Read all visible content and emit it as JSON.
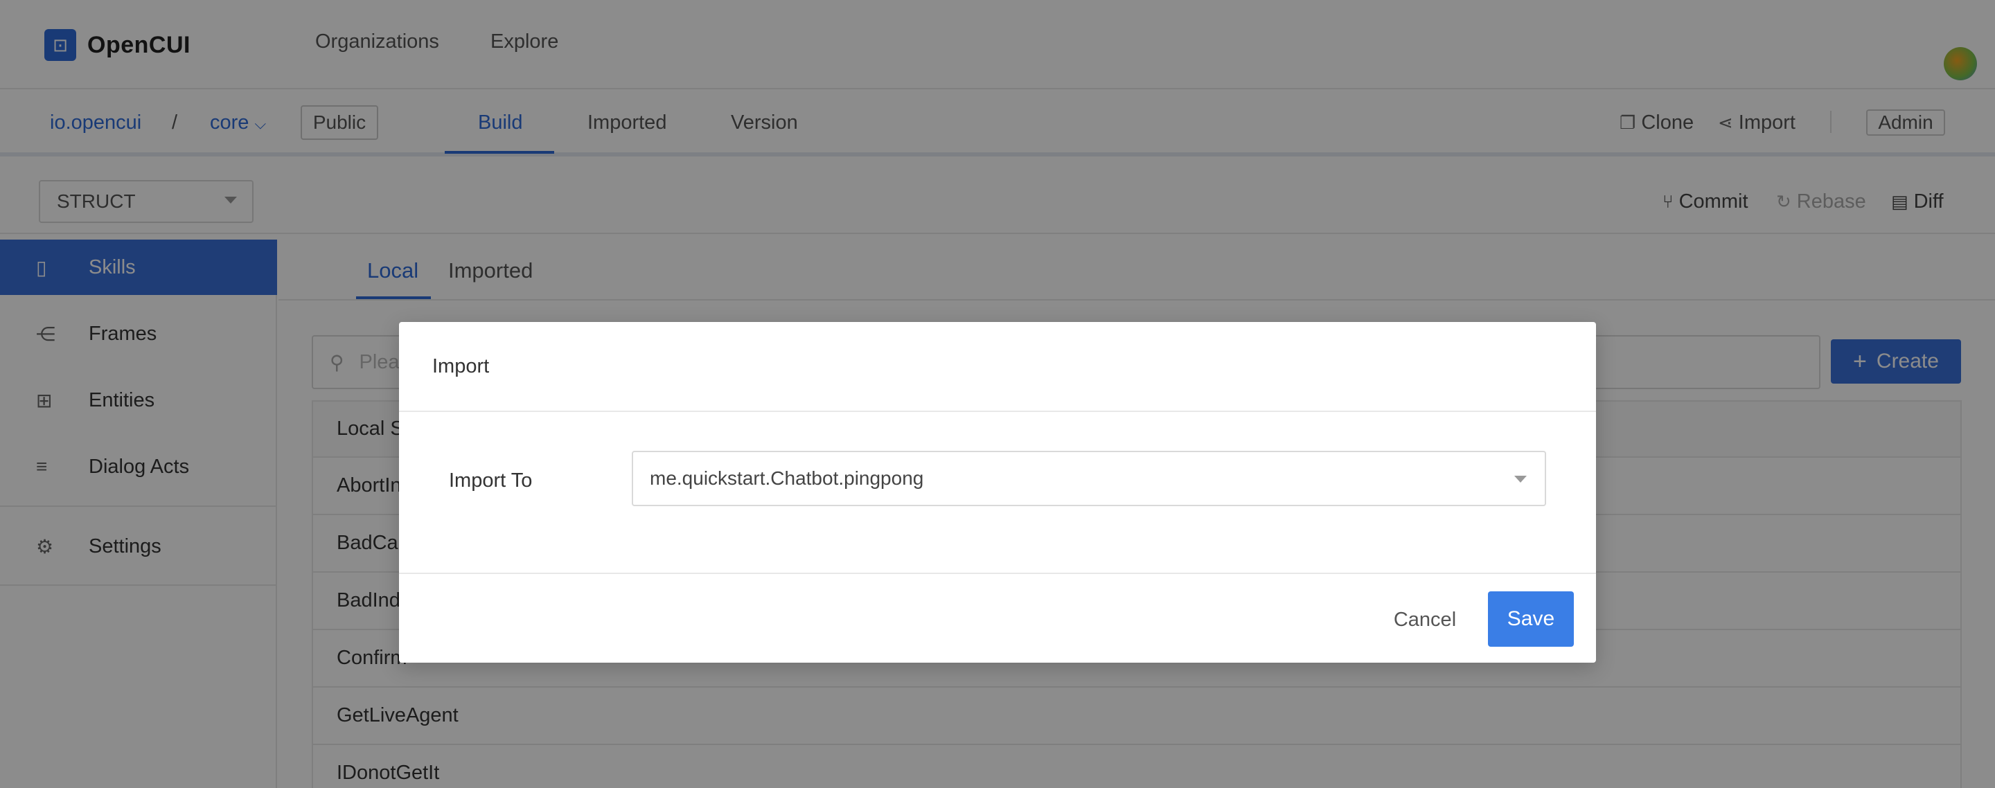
{
  "app": {
    "logo_mark": "⊡",
    "name": "OpenCUI"
  },
  "topnav": {
    "organizations": "Organizations",
    "explore": "Explore"
  },
  "breadcrumb": {
    "org": "io.opencui",
    "sep": "/",
    "project": "core",
    "project_caret": "⌵",
    "visibility": "Public"
  },
  "tabs": {
    "build": "Build",
    "imported": "Imported",
    "version": "Version"
  },
  "header_actions": {
    "clone": "Clone",
    "clone_icon": "❐",
    "import": "Import",
    "import_icon": "⋖",
    "admin": "Admin"
  },
  "toolbar": {
    "struct_value": "STRUCT",
    "commit": "Commit",
    "commit_icon": "⑂",
    "rebase": "Rebase",
    "rebase_icon": "↻",
    "diff": "Diff",
    "diff_icon": "▤"
  },
  "sidebar": {
    "items": [
      {
        "label": "Skills",
        "icon": "▯"
      },
      {
        "label": "Frames",
        "icon": "⋲"
      },
      {
        "label": "Entities",
        "icon": "⊞"
      },
      {
        "label": "Dialog Acts",
        "icon": "≡"
      },
      {
        "label": "Settings",
        "icon": "⚙"
      }
    ]
  },
  "subtabs": {
    "local": "Local",
    "imported": "Imported"
  },
  "search": {
    "placeholder": "Plea",
    "icon": "⚲"
  },
  "create": {
    "label": "Create",
    "icon": "+"
  },
  "table": {
    "header": "Local S",
    "rows": [
      "AbortIn",
      "BadCar",
      "BadInde",
      "Confirm",
      "GetLiveAgent",
      "IDonotGetIt"
    ]
  },
  "modal": {
    "title": "Import",
    "field_label": "Import To",
    "selected_value": "me.quickstart.Chatbot.pingpong",
    "cancel": "Cancel",
    "save": "Save"
  }
}
